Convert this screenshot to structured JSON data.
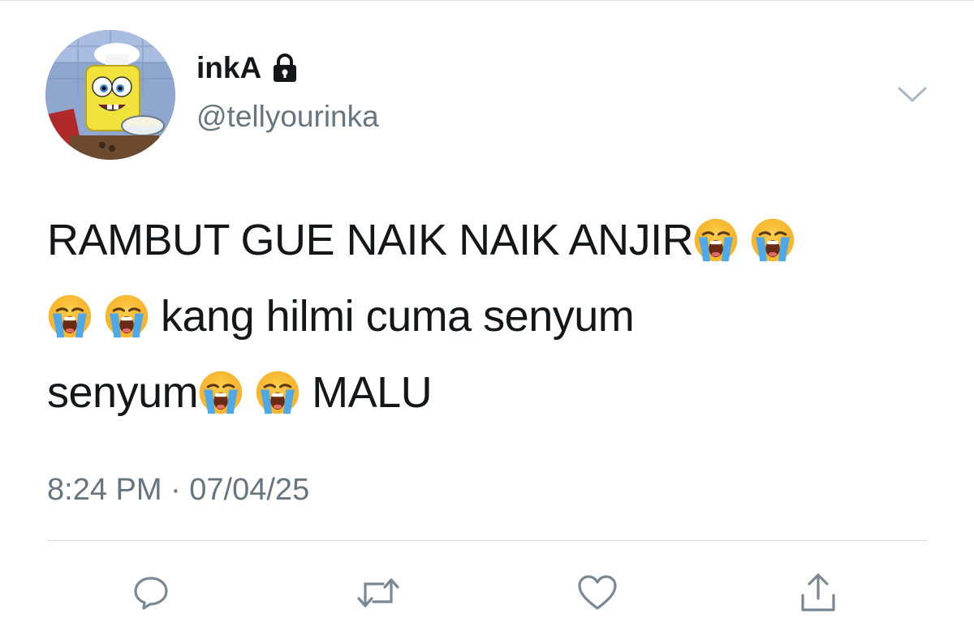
{
  "user": {
    "display_name": "inkA",
    "handle": "@tellyourinka",
    "avatar_icon": "spongebob-avatar",
    "protected_icon": "lock-icon"
  },
  "tweet": {
    "line1_text": "RAMBUT GUE NAIK NAIK ANJIR",
    "line2_text": "kang hilmi cuma senyum",
    "line3_text_a": "senyum",
    "line3_text_b": "MALU",
    "emoji": "loudly-crying-face",
    "timestamp": "8:24 PM · 07/04/25"
  },
  "actions": {
    "reply_icon": "reply-icon",
    "retweet_icon": "retweet-icon",
    "like_icon": "heart-icon",
    "share_icon": "share-icon"
  },
  "colors": {
    "text": "#14171a",
    "secondary": "#66757f",
    "icon": "#7a8895",
    "divider": "#d9dde1"
  }
}
